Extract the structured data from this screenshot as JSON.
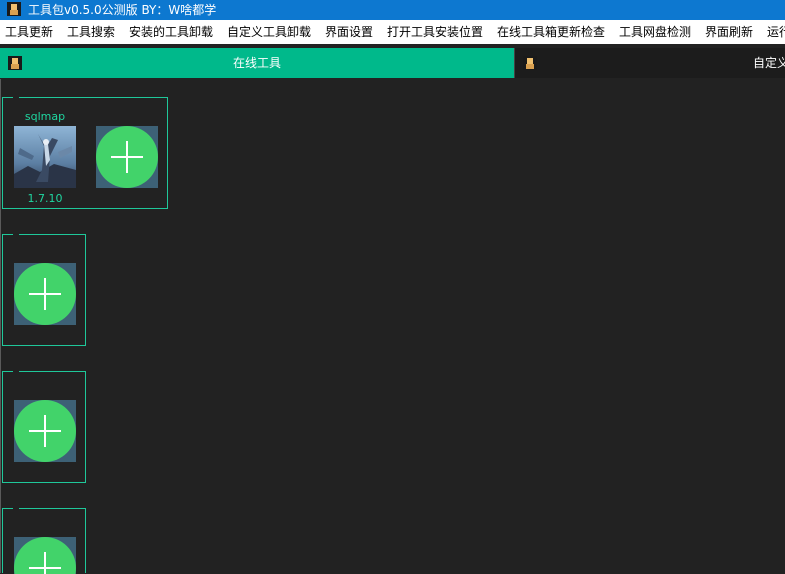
{
  "window": {
    "title": "工具包v0.5.0公测版  BY：W啥都学",
    "icon": "app-logo-icon"
  },
  "menu": [
    "工具更新",
    "工具搜索",
    "安装的工具卸载",
    "自定义工具卸载",
    "界面设置",
    "打开工具安装位置",
    "在线工具箱更新检查",
    "工具网盘检测",
    "界面刷新",
    "运行"
  ],
  "tabs": [
    {
      "label": "在线工具",
      "active": true,
      "icon": "app-logo-icon"
    },
    {
      "label": "自定义",
      "active": false,
      "icon": "app-logo-icon"
    }
  ],
  "groups": [
    {
      "tools": [
        {
          "name": "sqlmap",
          "version": "1.7.10"
        }
      ],
      "add_button": "add-icon"
    },
    {
      "tools": [],
      "add_button": "add-icon"
    },
    {
      "tools": [],
      "add_button": "add-icon"
    },
    {
      "tools": [],
      "add_button": "add-icon"
    }
  ],
  "colors": {
    "titlebar": "#0d78d0",
    "accent": "#00b98b",
    "background": "#222222",
    "add_circle": "#42d36a",
    "border": "#1fc89a"
  }
}
